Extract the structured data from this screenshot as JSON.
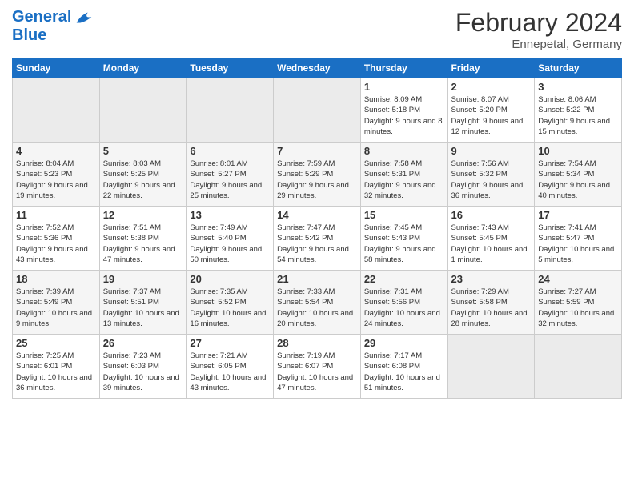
{
  "header": {
    "logo_line1": "General",
    "logo_line2": "Blue",
    "month": "February 2024",
    "location": "Ennepetal, Germany"
  },
  "days_of_week": [
    "Sunday",
    "Monday",
    "Tuesday",
    "Wednesday",
    "Thursday",
    "Friday",
    "Saturday"
  ],
  "weeks": [
    [
      {
        "day": "",
        "empty": true
      },
      {
        "day": "",
        "empty": true
      },
      {
        "day": "",
        "empty": true
      },
      {
        "day": "",
        "empty": true
      },
      {
        "day": "1",
        "sunrise": "8:09 AM",
        "sunset": "5:18 PM",
        "daylight": "9 hours and 8 minutes."
      },
      {
        "day": "2",
        "sunrise": "8:07 AM",
        "sunset": "5:20 PM",
        "daylight": "9 hours and 12 minutes."
      },
      {
        "day": "3",
        "sunrise": "8:06 AM",
        "sunset": "5:22 PM",
        "daylight": "9 hours and 15 minutes."
      }
    ],
    [
      {
        "day": "4",
        "sunrise": "8:04 AM",
        "sunset": "5:23 PM",
        "daylight": "9 hours and 19 minutes."
      },
      {
        "day": "5",
        "sunrise": "8:03 AM",
        "sunset": "5:25 PM",
        "daylight": "9 hours and 22 minutes."
      },
      {
        "day": "6",
        "sunrise": "8:01 AM",
        "sunset": "5:27 PM",
        "daylight": "9 hours and 25 minutes."
      },
      {
        "day": "7",
        "sunrise": "7:59 AM",
        "sunset": "5:29 PM",
        "daylight": "9 hours and 29 minutes."
      },
      {
        "day": "8",
        "sunrise": "7:58 AM",
        "sunset": "5:31 PM",
        "daylight": "9 hours and 32 minutes."
      },
      {
        "day": "9",
        "sunrise": "7:56 AM",
        "sunset": "5:32 PM",
        "daylight": "9 hours and 36 minutes."
      },
      {
        "day": "10",
        "sunrise": "7:54 AM",
        "sunset": "5:34 PM",
        "daylight": "9 hours and 40 minutes."
      }
    ],
    [
      {
        "day": "11",
        "sunrise": "7:52 AM",
        "sunset": "5:36 PM",
        "daylight": "9 hours and 43 minutes."
      },
      {
        "day": "12",
        "sunrise": "7:51 AM",
        "sunset": "5:38 PM",
        "daylight": "9 hours and 47 minutes."
      },
      {
        "day": "13",
        "sunrise": "7:49 AM",
        "sunset": "5:40 PM",
        "daylight": "9 hours and 50 minutes."
      },
      {
        "day": "14",
        "sunrise": "7:47 AM",
        "sunset": "5:42 PM",
        "daylight": "9 hours and 54 minutes."
      },
      {
        "day": "15",
        "sunrise": "7:45 AM",
        "sunset": "5:43 PM",
        "daylight": "9 hours and 58 minutes."
      },
      {
        "day": "16",
        "sunrise": "7:43 AM",
        "sunset": "5:45 PM",
        "daylight": "10 hours and 1 minute."
      },
      {
        "day": "17",
        "sunrise": "7:41 AM",
        "sunset": "5:47 PM",
        "daylight": "10 hours and 5 minutes."
      }
    ],
    [
      {
        "day": "18",
        "sunrise": "7:39 AM",
        "sunset": "5:49 PM",
        "daylight": "10 hours and 9 minutes."
      },
      {
        "day": "19",
        "sunrise": "7:37 AM",
        "sunset": "5:51 PM",
        "daylight": "10 hours and 13 minutes."
      },
      {
        "day": "20",
        "sunrise": "7:35 AM",
        "sunset": "5:52 PM",
        "daylight": "10 hours and 16 minutes."
      },
      {
        "day": "21",
        "sunrise": "7:33 AM",
        "sunset": "5:54 PM",
        "daylight": "10 hours and 20 minutes."
      },
      {
        "day": "22",
        "sunrise": "7:31 AM",
        "sunset": "5:56 PM",
        "daylight": "10 hours and 24 minutes."
      },
      {
        "day": "23",
        "sunrise": "7:29 AM",
        "sunset": "5:58 PM",
        "daylight": "10 hours and 28 minutes."
      },
      {
        "day": "24",
        "sunrise": "7:27 AM",
        "sunset": "5:59 PM",
        "daylight": "10 hours and 32 minutes."
      }
    ],
    [
      {
        "day": "25",
        "sunrise": "7:25 AM",
        "sunset": "6:01 PM",
        "daylight": "10 hours and 36 minutes."
      },
      {
        "day": "26",
        "sunrise": "7:23 AM",
        "sunset": "6:03 PM",
        "daylight": "10 hours and 39 minutes."
      },
      {
        "day": "27",
        "sunrise": "7:21 AM",
        "sunset": "6:05 PM",
        "daylight": "10 hours and 43 minutes."
      },
      {
        "day": "28",
        "sunrise": "7:19 AM",
        "sunset": "6:07 PM",
        "daylight": "10 hours and 47 minutes."
      },
      {
        "day": "29",
        "sunrise": "7:17 AM",
        "sunset": "6:08 PM",
        "daylight": "10 hours and 51 minutes."
      },
      {
        "day": "",
        "empty": true
      },
      {
        "day": "",
        "empty": true
      }
    ]
  ]
}
